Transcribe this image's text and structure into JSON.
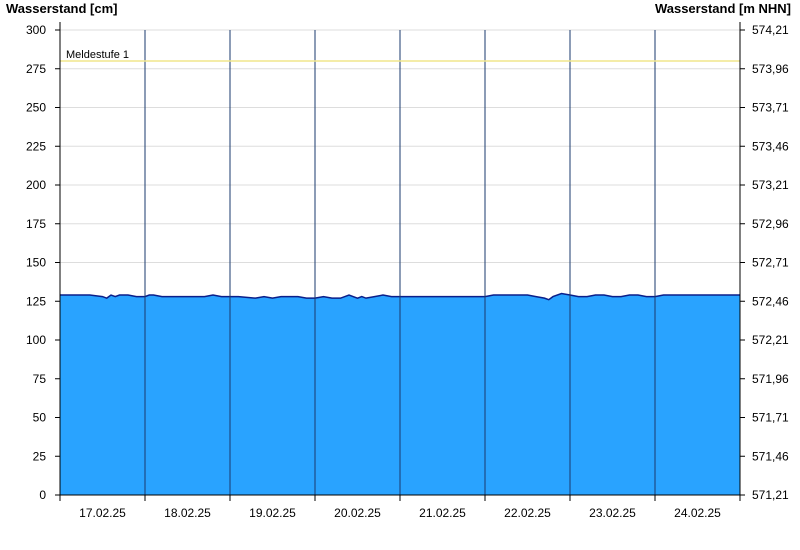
{
  "chart_data": {
    "type": "area",
    "left_axis_title": "Wasserstand [cm]",
    "right_axis_title": "Wasserstand [m NHN]",
    "ylim": [
      0,
      300
    ],
    "y_ticks": [
      0,
      25,
      50,
      75,
      100,
      125,
      150,
      175,
      200,
      225,
      250,
      275,
      300
    ],
    "right_y_ticks": [
      "571,21",
      "571,46",
      "571,71",
      "571,96",
      "572,21",
      "572,46",
      "572,71",
      "572,96",
      "573,21",
      "573,46",
      "573,71",
      "573,96",
      "574,21"
    ],
    "x_tick_labels": [
      "17.02.25",
      "18.02.25",
      "19.02.25",
      "20.02.25",
      "21.02.25",
      "22.02.25",
      "23.02.25",
      "24.02.25"
    ],
    "xlim_days": [
      0,
      8
    ],
    "grid": true,
    "reference_line": {
      "label": "Meldestufe 1",
      "value": 280,
      "color": "#f0e68c"
    },
    "series_color": "#29a3ff",
    "series_line_color": "#0b1f8a",
    "series": [
      {
        "x": [
          0,
          0.1,
          0.2,
          0.35,
          0.5,
          0.55,
          0.6,
          0.65,
          0.7,
          0.8,
          0.9,
          1.0,
          1.05,
          1.1,
          1.2,
          1.3,
          1.5,
          1.7,
          1.8,
          1.9,
          2.0,
          2.1,
          2.3,
          2.4,
          2.5,
          2.6,
          2.7,
          2.8,
          2.9,
          3.0,
          3.1,
          3.2,
          3.3,
          3.4,
          3.5,
          3.55,
          3.6,
          3.7,
          3.8,
          3.9,
          4.0,
          4.2,
          4.4,
          4.6,
          4.8,
          5.0,
          5.1,
          5.3,
          5.5,
          5.6,
          5.7,
          5.75,
          5.8,
          5.9,
          6.0,
          6.1,
          6.2,
          6.3,
          6.4,
          6.5,
          6.6,
          6.7,
          6.8,
          6.9,
          7.0,
          7.1,
          7.2,
          7.4,
          7.6,
          7.8,
          8.0
        ],
        "y": [
          129,
          129,
          129,
          129,
          128,
          127,
          129,
          128,
          129,
          129,
          128,
          128,
          129,
          129,
          128,
          128,
          128,
          128,
          129,
          128,
          128,
          128,
          127,
          128,
          127,
          128,
          128,
          128,
          127,
          127,
          128,
          127,
          127,
          129,
          127,
          128,
          127,
          128,
          129,
          128,
          128,
          128,
          128,
          128,
          128,
          128,
          129,
          129,
          129,
          128,
          127,
          126,
          128,
          130,
          129,
          128,
          128,
          129,
          129,
          128,
          128,
          129,
          129,
          128,
          128,
          129,
          129,
          129,
          129,
          129,
          129
        ]
      }
    ]
  }
}
